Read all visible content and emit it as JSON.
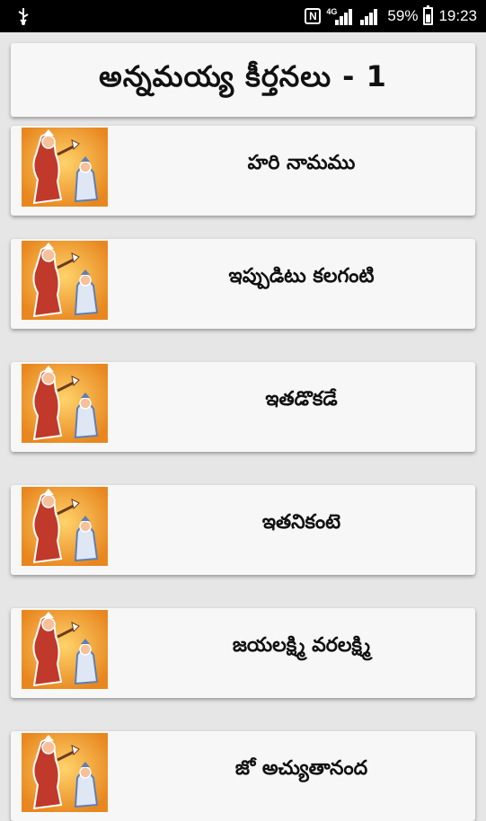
{
  "status_bar": {
    "usb_icon": "usb-icon",
    "network_type": "4G",
    "battery": "59%",
    "time": "19:23"
  },
  "header": {
    "title": "అన్నమయ్య కీర్తనలు - 1"
  },
  "songs": [
    {
      "title": "హరి నామము"
    },
    {
      "title": "ఇప్పుడిటు కలగంటి"
    },
    {
      "title": "ఇతడొకడే"
    },
    {
      "title": "ఇతనికంటె"
    },
    {
      "title": "జయలక్ష్మి వరలక్ష్మి"
    },
    {
      "title": "జో అచ్యుతానంద"
    }
  ],
  "colors": {
    "status_bg": "#000000",
    "page_bg": "#e6e6e6",
    "card_bg": "#f7f7f7",
    "thumb_orange": "#f2a23a"
  }
}
